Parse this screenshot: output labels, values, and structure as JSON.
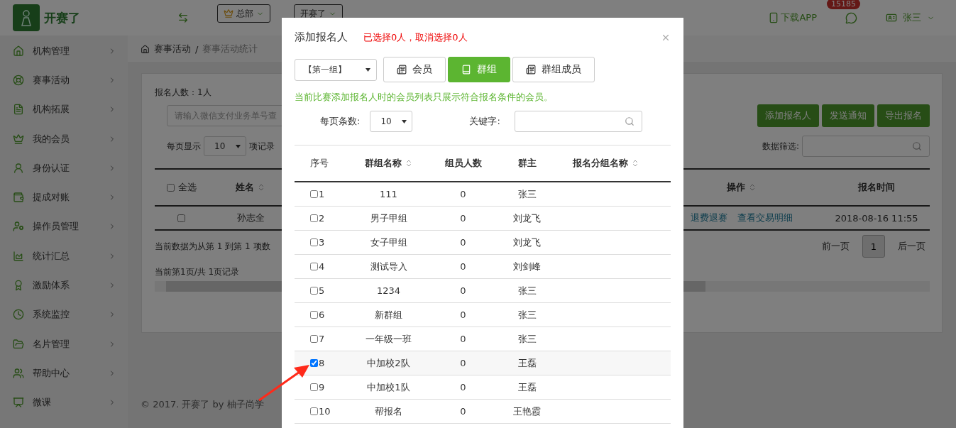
{
  "header": {
    "brand": "开赛了",
    "org_select": "总部",
    "org_select_2": "开赛了",
    "download_app": "下载APP",
    "notification_count": "15185",
    "user_name": "张三"
  },
  "sidebar": {
    "items": [
      {
        "label": "机构管理"
      },
      {
        "label": "赛事活动"
      },
      {
        "label": "机构拓展"
      },
      {
        "label": "我的会员"
      },
      {
        "label": "身份认证"
      },
      {
        "label": "提成对账"
      },
      {
        "label": "操作员管理"
      },
      {
        "label": "统计汇总"
      },
      {
        "label": "激励体系"
      },
      {
        "label": "系统监控"
      },
      {
        "label": "名片管理"
      },
      {
        "label": "帮助中心"
      },
      {
        "label": "微课"
      }
    ]
  },
  "breadcrumb": {
    "separator": "/",
    "items": [
      "赛事活动",
      "赛事活动统计"
    ]
  },
  "content": {
    "signup_count": "报名人数：1人",
    "search_placeholder": "请输入微信支付业务单号查",
    "buttons": [
      "添加报名人",
      "发送通知",
      "导出报名"
    ],
    "page_size_before": "每页显示",
    "page_size": "10",
    "page_size_after": "项记录",
    "filter_label": "数据筛选:",
    "table": {
      "select_all": {
        "label": "全选",
        "checked": false
      },
      "columns": [
        {
          "label": "姓名",
          "sortable": true
        },
        {
          "label": "操作",
          "sortable": true
        },
        {
          "label": "报名时间",
          "sortable": false
        }
      ],
      "rows": [
        {
          "checked": false,
          "name": "孙志全",
          "actions": [
            "退费退赛",
            "查看交易明细"
          ],
          "time": "2018-08-16 11:55"
        }
      ]
    },
    "info": "当前数据为从第 1 到第 1 项数",
    "pager": {
      "prev": "前一页",
      "pages": [
        {
          "label": "1",
          "selected": true
        }
      ],
      "next": "后一页"
    },
    "page_status": "当前第1页/共 1页记录"
  },
  "footer": "© 2017. 开赛了 by 柚子尚学",
  "modal": {
    "title": "添加报名人",
    "selection_status": "已选择0人，取消选择0人",
    "group_select": "【第一组】",
    "tabs": [
      {
        "label": "会员",
        "selected": false
      },
      {
        "label": "群组",
        "selected": true
      },
      {
        "label": "群组成员",
        "selected": false
      }
    ],
    "note": "当前比赛添加报名人时的会员列表只展示符合报名条件的会员。",
    "page_size_label": "每页条数:",
    "page_size": "10",
    "keyword_label": "关键字:",
    "columns": [
      {
        "label": "序号",
        "sortable": false
      },
      {
        "label": "群组名称",
        "sortable": true
      },
      {
        "label": "组员人数",
        "sortable": false
      },
      {
        "label": "群主",
        "sortable": false
      },
      {
        "label": "报名分组名称",
        "sortable": true
      }
    ],
    "rows": [
      {
        "index": "1",
        "checked": false,
        "name": "111",
        "members": "0",
        "owner": "张三"
      },
      {
        "index": "2",
        "checked": false,
        "name": "男子甲组",
        "members": "0",
        "owner": "刘龙飞"
      },
      {
        "index": "3",
        "checked": false,
        "name": "女子甲组",
        "members": "0",
        "owner": "刘龙飞"
      },
      {
        "index": "4",
        "checked": false,
        "name": "测试导入",
        "members": "0",
        "owner": "刘剑峰"
      },
      {
        "index": "5",
        "checked": false,
        "name": "1234",
        "members": "0",
        "owner": "张三"
      },
      {
        "index": "6",
        "checked": false,
        "name": "新群组",
        "members": "0",
        "owner": "张三"
      },
      {
        "index": "7",
        "checked": false,
        "name": "一年级一班",
        "members": "0",
        "owner": "张三"
      },
      {
        "index": "8",
        "checked": true,
        "name": "中加校2队",
        "members": "0",
        "owner": "王磊"
      },
      {
        "index": "9",
        "checked": false,
        "name": "中加校1队",
        "members": "0",
        "owner": "王磊"
      },
      {
        "index": "10",
        "checked": false,
        "name": "帮报名",
        "members": "0",
        "owner": "王艳霞"
      }
    ]
  }
}
